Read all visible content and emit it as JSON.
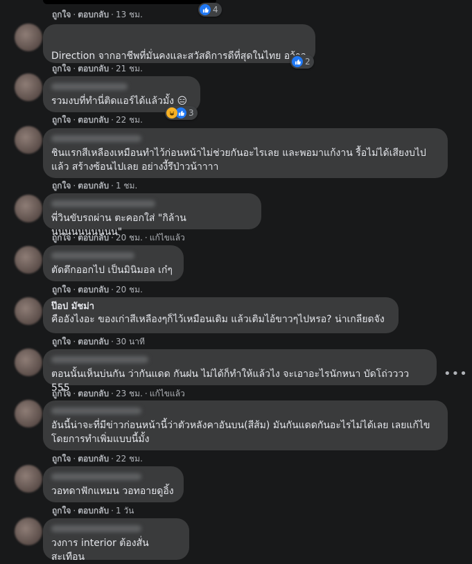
{
  "actions": {
    "like": "ถูกใจ",
    "reply": "ตอบกลับ",
    "edited": "แก้ไขแล้ว",
    "sep": "·"
  },
  "top": {
    "time": "13 ชม.",
    "reactions": "4"
  },
  "comments": [
    {
      "author": "",
      "text": "Direction จากอาชีพที่มั่นคงและสวัสดิการดีที่สุดในไทย อว้าว",
      "time": "21 ชม.",
      "reactions": "2"
    },
    {
      "author": "",
      "text": "รวมงบที่ทำนี่ติดแอร์ได้แล้วมั้ง 😑",
      "time": "22 ชม.",
      "reactions": "3"
    },
    {
      "author": "",
      "text": "ชินแรกสีเหลืองเหมือนทำไว้ก่อนหน้าไม่ช่วยกันอะไรเลย และพอมาแก้งาน รื้อไม่ได้เสียงบไป แล้ว สร้างซ้อนไปเลย อย่างงี้รึป่าวน้าาาา",
      "time": "1 ชม."
    },
    {
      "author": "",
      "text": "พี่วินขับรถผ่าน ตะคอกใส่ \"กิล้านนนนนนนนนนน\"",
      "time": "20 ชม."
    },
    {
      "author": "",
      "text": "ตัดตึกออกไป เป็นมินิมอล เก๋ๆ",
      "time": "20 ชม."
    },
    {
      "author": "ป๊อป มัชม่า",
      "text": "คืออังไงอะ ของเก่าสีเหลืองๆก็ไว้เหมือนเดิม แล้วเติมไอ้ขาวๆไปหรอ? น่าเกลียดจัง",
      "time": "30 นาที"
    },
    {
      "author": "",
      "text": "ตอนนั้นเห็นบ่นกัน ว่ากันแดด กันฝน ไม่ได้ก็ทำให้แล้วไง จะเอาอะไรนักหนา บัดโถ่วววว 555",
      "time": "23 ชม."
    },
    {
      "author": "",
      "text": "อันนี้น่าจะที่มีข่าวก่อนหน้านี้ว่าตัวหลังคาอันบน(สีส้ม) มันกันแดดกันอะไรไม่ได้เลย เลยแก้ไข โดยการทำเพิ่มแบบนี้มั้ง",
      "time": "22 ชม."
    },
    {
      "author": "",
      "text": "วอทดาฟักแหมน วอทอายดูอิ้ง",
      "time": "1 วัน"
    },
    {
      "author": "",
      "text": "วงการ interior ต้องสั่นสะเทือน"
    }
  ],
  "colors": {
    "like": "#2078f4",
    "haha": "#f7b125",
    "bubble": "#3a3b3c",
    "bg": "#18191a"
  }
}
